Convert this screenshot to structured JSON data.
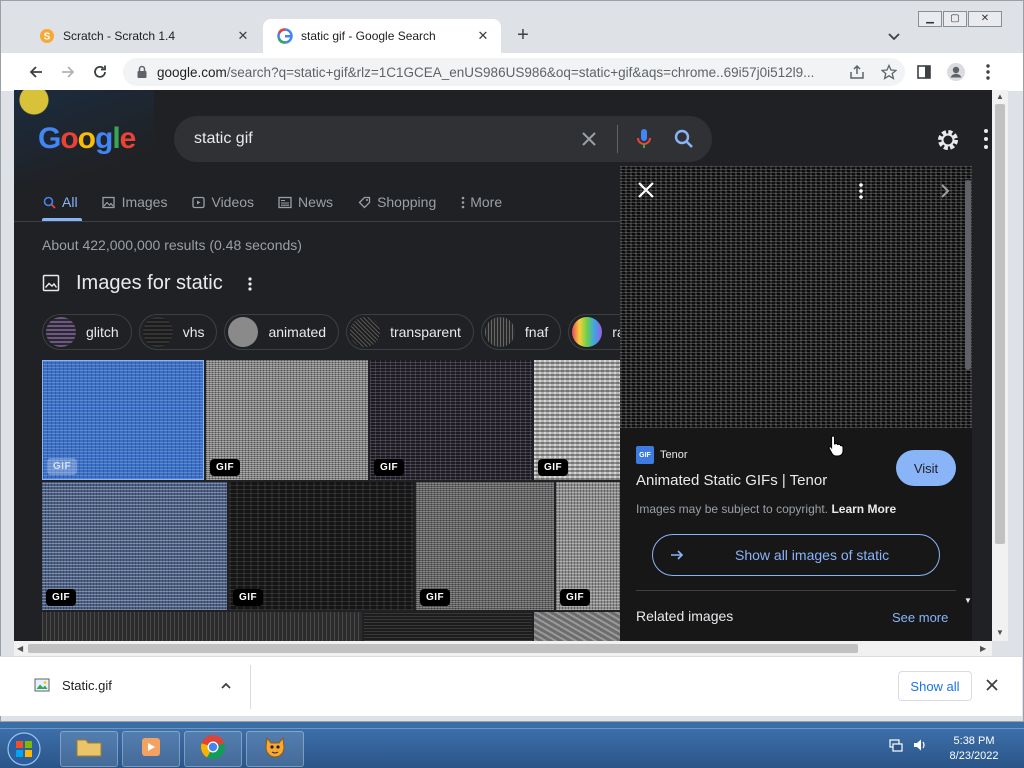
{
  "browser": {
    "tabs": [
      {
        "title": "Scratch - Scratch 1.4",
        "active": false
      },
      {
        "title": "static gif - Google Search",
        "active": true
      }
    ],
    "url_host": "google.com",
    "url_rest": "/search?q=static+gif&rlz=1C1GCEA_enUS986US986&oq=static+gif&aqs=chrome..69i57j0i512l9...",
    "new_tab": "+",
    "window_controls": [
      "minimize-icon",
      "maximize-icon",
      "close-icon"
    ]
  },
  "page": {
    "logo_letters": [
      {
        "ch": "G",
        "color": "#4285f4"
      },
      {
        "ch": "o",
        "color": "#ea4335"
      },
      {
        "ch": "o",
        "color": "#fbbc05"
      },
      {
        "ch": "g",
        "color": "#4285f4"
      },
      {
        "ch": "l",
        "color": "#34a853"
      },
      {
        "ch": "e",
        "color": "#ea4335"
      }
    ],
    "search_query": "static gif",
    "nav_tabs": [
      {
        "label": "All",
        "icon": "search-icon",
        "active": true
      },
      {
        "label": "Images",
        "icon": "image-icon"
      },
      {
        "label": "Videos",
        "icon": "play-icon"
      },
      {
        "label": "News",
        "icon": "news-icon"
      },
      {
        "label": "Shopping",
        "icon": "tag-icon"
      },
      {
        "label": "More",
        "icon": "more-vert-icon"
      }
    ],
    "result_stats": "About 422,000,000 results (0.48 seconds)",
    "images_heading": "Images for static",
    "chips": [
      "glitch",
      "vhs",
      "animated",
      "transparent",
      "fnaf",
      "rainb"
    ],
    "gif_badge": "GIF"
  },
  "panel": {
    "source": "Tenor",
    "source_icon": "GIF",
    "title": "Animated Static GIFs | Tenor",
    "visit": "Visit",
    "copyright": "Images may be subject to copyright.",
    "learn_more": "Learn More",
    "show_all": "Show all images of static",
    "related": "Related images",
    "see_more": "See more"
  },
  "downloads": {
    "filename": "Static.gif",
    "show_all": "Show all"
  },
  "taskbar": {
    "time": "5:38 PM",
    "date": "8/23/2022"
  },
  "colors": {
    "accent_blue": "#8ab4f8",
    "page_bg": "#202124",
    "link_blue": "#1a73e8"
  }
}
